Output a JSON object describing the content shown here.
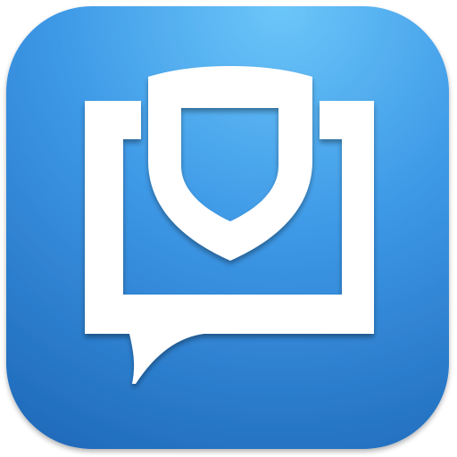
{
  "app_icon": {
    "icon": "secure-chat-shield-icon",
    "colors": {
      "background_top": "#6CC6F9",
      "background_mid": "#3D98E6",
      "background_bottom": "#1E68B8",
      "glyph": "#FFFFFF",
      "glyph_shadow": "#0D3E78"
    }
  }
}
